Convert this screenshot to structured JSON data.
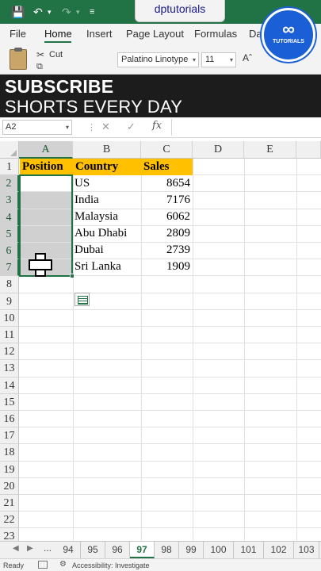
{
  "titlebar": {
    "doc_title": "dptutorials"
  },
  "ribbon": {
    "tabs": [
      "File",
      "Home",
      "Insert",
      "Page Layout",
      "Formulas",
      "Da"
    ],
    "active_tab": "Home",
    "cut_label": "Cut",
    "font_name": "Palatino Linotype",
    "font_size": "11"
  },
  "logo": {
    "text": "TUTORIALS",
    "color": "#1b5fd6"
  },
  "banner": {
    "title": "SUBSCRIBE",
    "subtitle": "SHORTS EVERY DAY"
  },
  "formula_bar": {
    "name_box": "A2",
    "fx": "fx",
    "content": ""
  },
  "grid": {
    "columns": [
      "A",
      "B",
      "C",
      "D",
      "E"
    ],
    "selected_column": "A",
    "rows": [
      "1",
      "2",
      "3",
      "4",
      "5",
      "6",
      "7",
      "8",
      "9",
      "10",
      "11",
      "12",
      "13",
      "14",
      "15",
      "16",
      "17",
      "18",
      "19",
      "20",
      "21",
      "22",
      "23"
    ],
    "selected_rows": [
      "2",
      "3",
      "4",
      "5",
      "6",
      "7"
    ],
    "header_row": [
      "Position",
      "Country",
      "Sales"
    ],
    "data": [
      {
        "position": "",
        "country": "US",
        "sales": "8654"
      },
      {
        "position": "",
        "country": "India",
        "sales": "7176"
      },
      {
        "position": "",
        "country": "Malaysia",
        "sales": "6062"
      },
      {
        "position": "",
        "country": "Abu Dhabi",
        "sales": "2809"
      },
      {
        "position": "",
        "country": "Dubai",
        "sales": "2739"
      },
      {
        "position": "",
        "country": "Sri Lanka",
        "sales": "1909"
      }
    ],
    "header_fill": "#ffc000",
    "selection_color": "#217346"
  },
  "sheet_tabs": {
    "ellipsis": "...",
    "tabs": [
      "94",
      "95",
      "96",
      "97",
      "98",
      "99",
      "100",
      "101",
      "102",
      "103"
    ],
    "active": "97"
  },
  "status_bar": {
    "ready": "Ready",
    "accessibility": "Accessibility: Investigate"
  }
}
